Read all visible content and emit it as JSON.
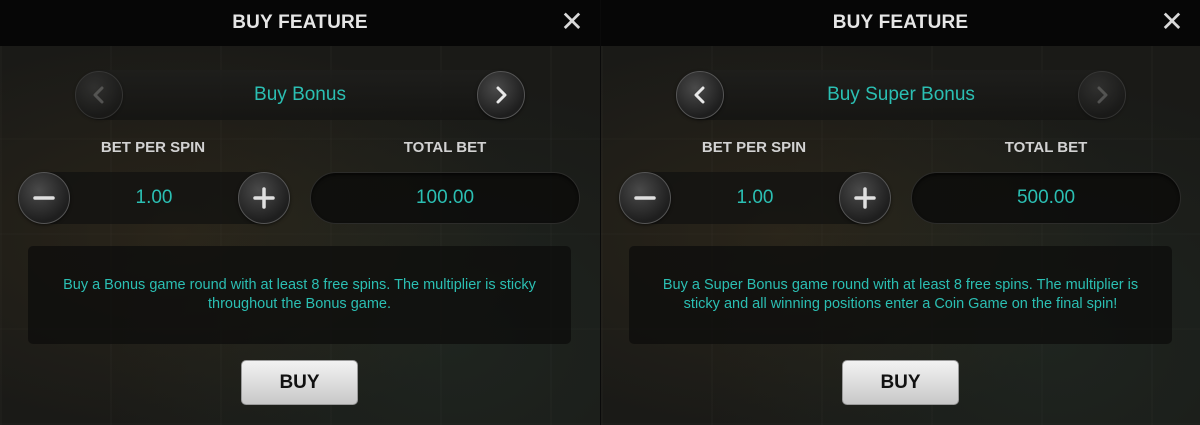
{
  "panels": [
    {
      "title": "BUY FEATURE",
      "close_symbol": "✕",
      "feature_name": "Buy Bonus",
      "left_arrow_enabled": false,
      "right_arrow_enabled": true,
      "bet_per_spin_label": "BET PER SPIN",
      "total_bet_label": "TOTAL BET",
      "bet_per_spin_value": "1.00",
      "total_bet_value": "100.00",
      "description": "Buy a Bonus game round with at least 8 free spins. The multiplier is sticky throughout the Bonus game.",
      "buy_label": "BUY"
    },
    {
      "title": "BUY FEATURE",
      "close_symbol": "✕",
      "feature_name": "Buy Super Bonus",
      "left_arrow_enabled": true,
      "right_arrow_enabled": false,
      "bet_per_spin_label": "BET PER SPIN",
      "total_bet_label": "TOTAL BET",
      "bet_per_spin_value": "1.00",
      "total_bet_value": "500.00",
      "description": "Buy a Super Bonus game round with at least 8 free spins. The multiplier is sticky and all winning positions enter a Coin Game on the final spin!",
      "buy_label": "BUY"
    }
  ],
  "colors": {
    "accent_teal": "#2bbfb3",
    "title_text": "#e6e6e6",
    "header_bg": "#060606"
  },
  "icons": {
    "close": "close-icon",
    "prev": "chevron-left-icon",
    "next": "chevron-right-icon",
    "decrease": "minus-icon",
    "increase": "plus-icon"
  }
}
